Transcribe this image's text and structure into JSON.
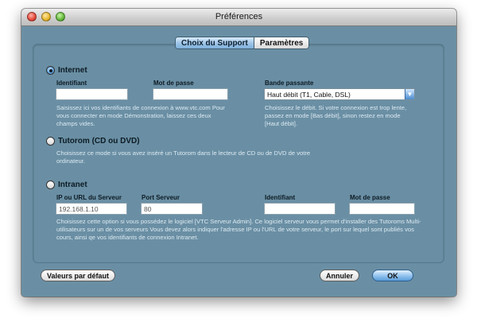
{
  "window": {
    "title": "Préférences"
  },
  "tabs": [
    {
      "label": "Choix du Support",
      "active": true
    },
    {
      "label": "Paramètres",
      "active": false
    }
  ],
  "internet": {
    "label": "Internet",
    "selected": true,
    "identifiant_label": "Identifiant",
    "identifiant_value": "",
    "mot_de_passe_label": "Mot de passe",
    "mot_de_passe_value": "",
    "bande_label": "Bande passante",
    "bande_value": "Haut débit (T1, Cable, DSL)",
    "help_left": "Saisissez ici vos identifiants de connexion à www.vtc.com Pour vous connecter en mode Démonstration, laissez ces deux champs vides.",
    "help_right": "Choisissez le débit. Si votre connexion est trop lente, passez en mode [Bas débit], sinon restez en mode [Haut débit]."
  },
  "tutorom": {
    "label": "Tutorom (CD ou DVD)",
    "selected": false,
    "help": "Choisissez ce mode si vous avez inséré un Tutorom dans le lecteur de CD ou de DVD de votre ordinateur."
  },
  "intranet": {
    "label": "Intranet",
    "selected": false,
    "ip_label": "IP ou URL du Serveur",
    "ip_value": "192.168.1.10",
    "port_label": "Port Serveur",
    "port_value": "80",
    "identifiant_label": "Identifiant",
    "identifiant_value": "",
    "mot_de_passe_label": "Mot de passe",
    "mot_de_passe_value": "",
    "help": "Choisissez cette option si vous possédez le logiciel [VTC Serveur Admin]. Ce logiciel serveur vous permet d'installer des Tutoroms Multi-utilisateurs sur un de vos serveurs Vous devez alors indiquer l'adresse IP ou l'URL de votre serveur, le port sur lequel sont publiés vos cours, ainsi qe vos identifiants de connexion Intranet."
  },
  "buttons": {
    "defaults": "Valeurs par défaut",
    "cancel": "Annuler",
    "ok": "OK"
  }
}
